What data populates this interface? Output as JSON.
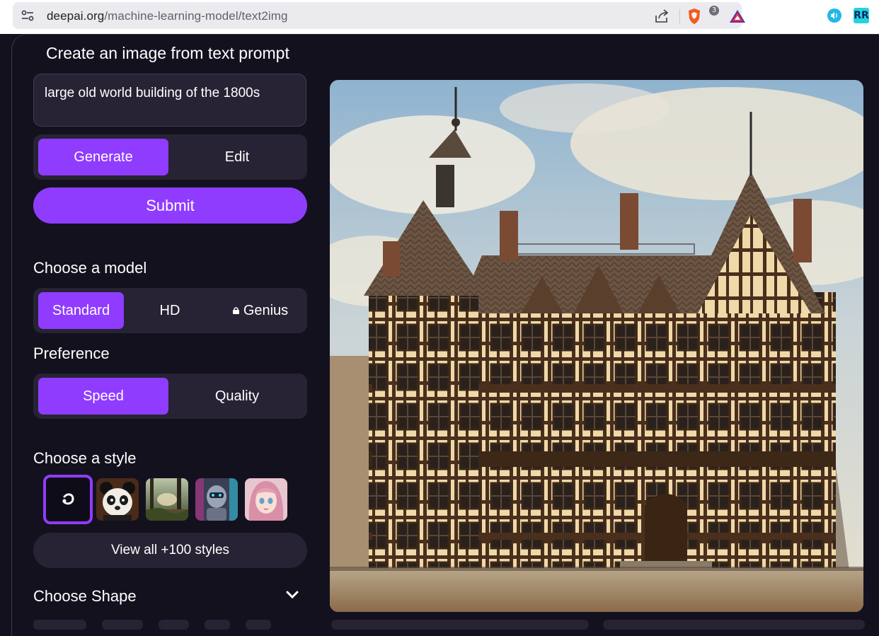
{
  "browser": {
    "url_domain": "deepai.org",
    "url_path": "/machine-learning-model/text2img",
    "shields_badge": "3",
    "extension_rr_label": "RR"
  },
  "page": {
    "title": "Create an image from text prompt",
    "prompt_value": "large old world building of the 1800s",
    "mode_tabs": [
      "Generate",
      "Edit"
    ],
    "mode_selected": "Generate",
    "submit_label": "Submit",
    "model_heading": "Choose a model",
    "models": [
      "Standard",
      "HD",
      "Genius"
    ],
    "model_selected": "Standard",
    "preference_heading": "Preference",
    "preferences": [
      "Speed",
      "Quality"
    ],
    "preference_selected": "Speed",
    "style_heading": "Choose a style",
    "styles": [
      "default-style",
      "panda-style",
      "forest-style",
      "cyborg-style",
      "anime-girl-style"
    ],
    "style_selected": "default-style",
    "view_all_label": "View all +100 styles",
    "shape_heading": "Choose Shape"
  },
  "colors": {
    "accent": "#8f3cff",
    "background": "#14111f",
    "panel": "#272334"
  },
  "icons": [
    "site-info-icon",
    "share-icon",
    "brave-shields-icon",
    "brave-rewards-icon",
    "audio-extension-icon",
    "lock-icon",
    "chevron-down-icon"
  ]
}
